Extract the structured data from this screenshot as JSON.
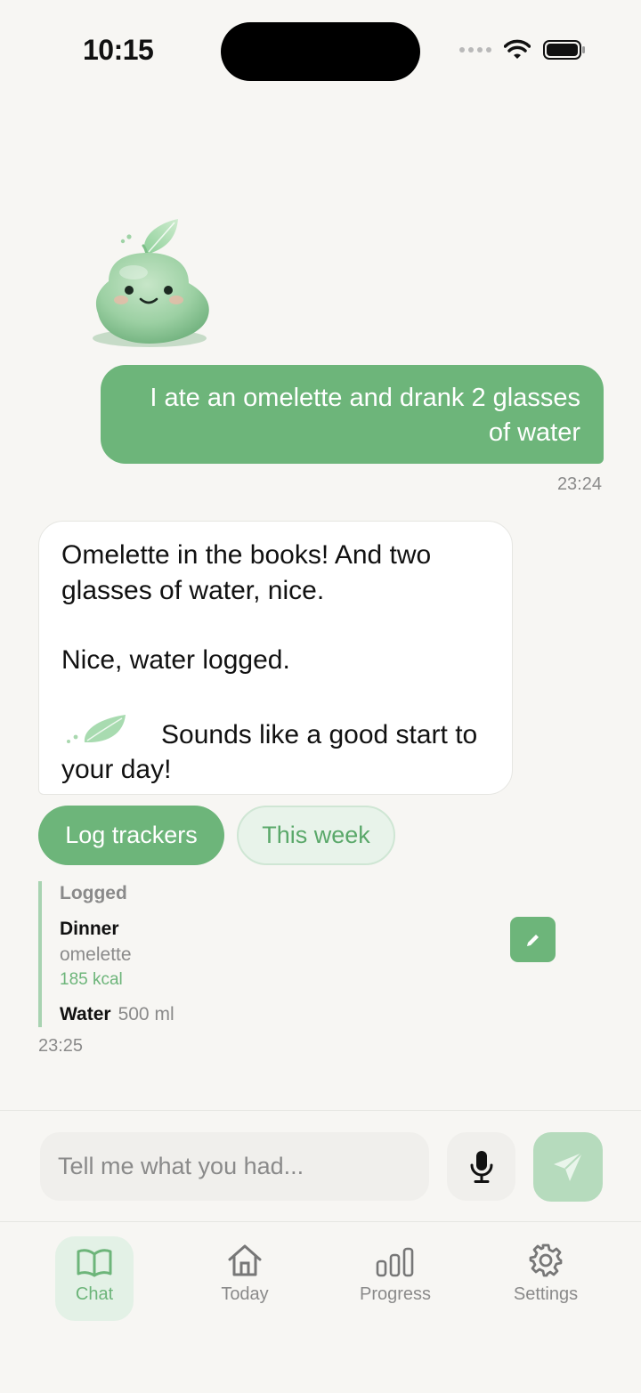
{
  "status_bar": {
    "time": "10:15"
  },
  "conversation": {
    "user_message": {
      "text": "I ate an omelette and drank 2 glasses of water",
      "time": "23:24"
    },
    "bot_message": {
      "line1": "Omelette in the books! And two glasses of water, nice.",
      "line2": "Nice, water logged.",
      "line3": "Sounds like a good start to your day!"
    },
    "quick_replies": {
      "primary": "Log trackers",
      "secondary": "This week"
    },
    "logged": {
      "title": "Logged",
      "meal": {
        "name": "Dinner",
        "food": "omelette",
        "calories": "185 kcal"
      },
      "water": {
        "label": "Water",
        "amount": "500 ml"
      },
      "time": "23:25"
    }
  },
  "composer": {
    "placeholder": "Tell me what you had..."
  },
  "tabs": [
    {
      "label": "Chat",
      "icon": "book-icon",
      "active": true
    },
    {
      "label": "Today",
      "icon": "home-icon",
      "active": false
    },
    {
      "label": "Progress",
      "icon": "bar-chart-icon",
      "active": false
    },
    {
      "label": "Settings",
      "icon": "gear-icon",
      "active": false
    }
  ],
  "colors": {
    "accent": "#6db57a",
    "accent_light": "#e8f3ea",
    "background": "#f7f6f3",
    "muted_text": "#8a8a8a"
  }
}
